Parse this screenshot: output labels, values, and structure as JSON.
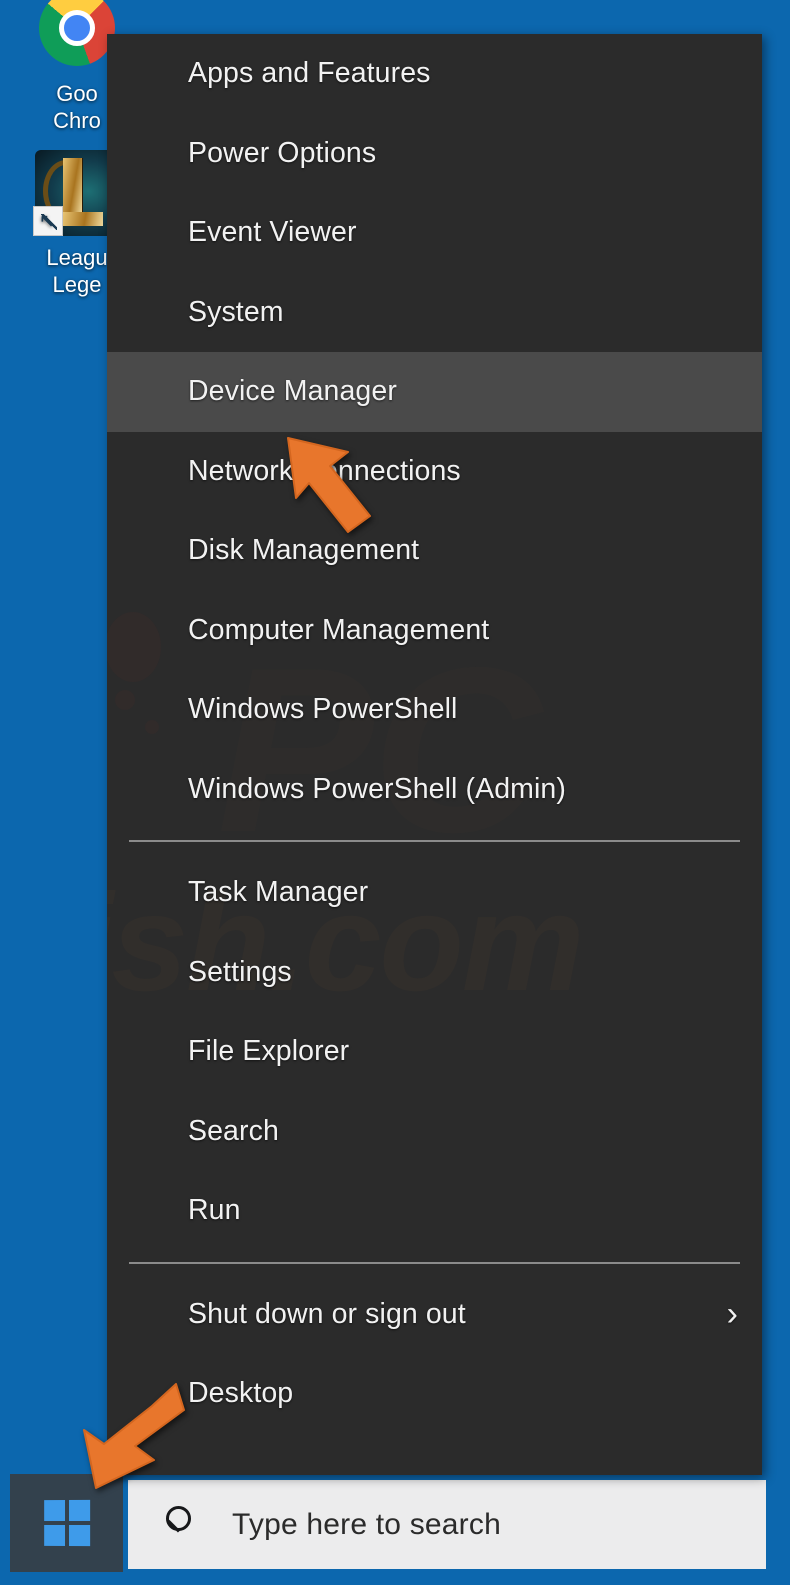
{
  "desktop": {
    "background_color": "#0c67ae",
    "icons": [
      {
        "name": "Google Chrome",
        "label_lines": [
          "Goo",
          "Chro"
        ],
        "icon": "chrome-icon",
        "has_shortcut_overlay": false
      },
      {
        "name": "League of Legends",
        "label_lines": [
          "Leagu",
          "Lege"
        ],
        "icon": "league-of-legends-icon",
        "has_shortcut_overlay": true
      }
    ]
  },
  "winx_menu": {
    "background_color": "#2b2b2b",
    "highlight_color": "#4a4a4a",
    "text_color": "#f2f2f2",
    "groups": [
      {
        "items": [
          {
            "label": "Apps and Features",
            "highlighted": false,
            "submenu": false
          },
          {
            "label": "Power Options",
            "highlighted": false,
            "submenu": false
          },
          {
            "label": "Event Viewer",
            "highlighted": false,
            "submenu": false
          },
          {
            "label": "System",
            "highlighted": false,
            "submenu": false
          },
          {
            "label": "Device Manager",
            "highlighted": true,
            "submenu": false
          },
          {
            "label": "Network Connections",
            "highlighted": false,
            "submenu": false
          },
          {
            "label": "Disk Management",
            "highlighted": false,
            "submenu": false
          },
          {
            "label": "Computer Management",
            "highlighted": false,
            "submenu": false
          },
          {
            "label": "Windows PowerShell",
            "highlighted": false,
            "submenu": false
          },
          {
            "label": "Windows PowerShell (Admin)",
            "highlighted": false,
            "submenu": false
          }
        ]
      },
      {
        "items": [
          {
            "label": "Task Manager",
            "highlighted": false,
            "submenu": false
          },
          {
            "label": "Settings",
            "highlighted": false,
            "submenu": false
          },
          {
            "label": "File Explorer",
            "highlighted": false,
            "submenu": false
          },
          {
            "label": "Search",
            "highlighted": false,
            "submenu": false
          },
          {
            "label": "Run",
            "highlighted": false,
            "submenu": false
          }
        ]
      },
      {
        "items": [
          {
            "label": "Shut down or sign out",
            "highlighted": false,
            "submenu": true,
            "submenu_glyph": "›"
          },
          {
            "label": "Desktop",
            "highlighted": false,
            "submenu": false
          }
        ]
      }
    ]
  },
  "watermark": {
    "logo_text": "PC",
    "domain_text": "ish.com"
  },
  "taskbar": {
    "background_color": "#0c67ae",
    "start_button": {
      "name": "start-button",
      "icon": "windows-logo-icon",
      "background_color": "#33414d",
      "logo_color": "#3e9bea"
    },
    "search": {
      "icon": "search-icon",
      "placeholder": "Type here to search",
      "value": "",
      "background_color": "#ececed"
    }
  },
  "annotations": {
    "color": "#e8762c",
    "arrows": [
      {
        "name": "pointer-device-manager",
        "target": "Device Manager",
        "direction": "up-left"
      },
      {
        "name": "pointer-start-button",
        "target": "Start button",
        "direction": "down-left"
      }
    ]
  }
}
